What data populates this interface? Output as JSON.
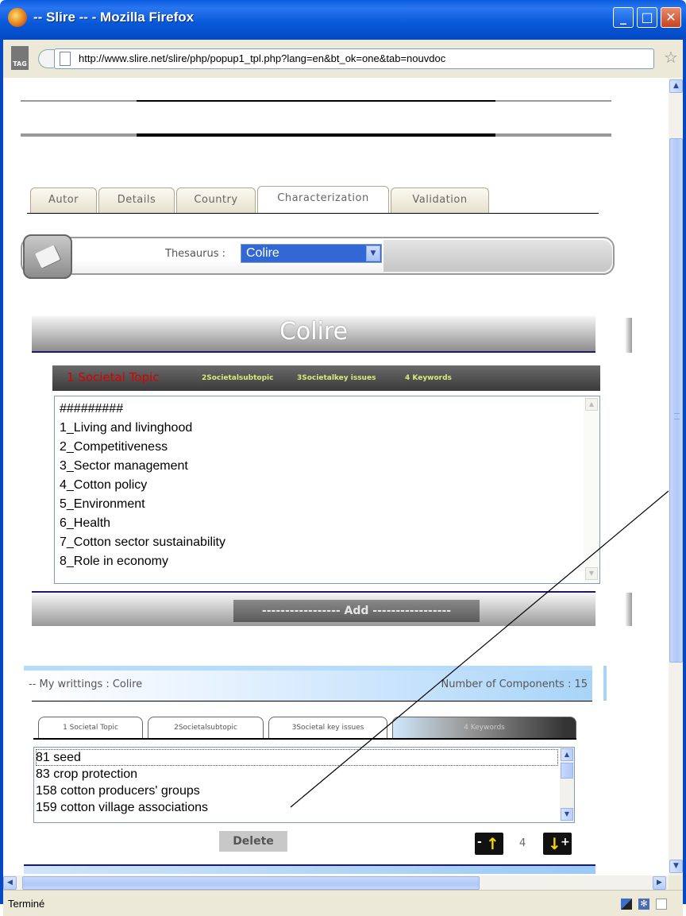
{
  "window": {
    "title": "-- Slire -- - Mozilla Firefox",
    "minimize": "_",
    "maximize": "□",
    "close": "✕"
  },
  "urlbar": {
    "url": "http://www.slire.net/slire/php/popup1_tpl.php?lang=en&bt_ok=one&tab=nouvdoc",
    "tag_label": "TAG"
  },
  "tabs": [
    {
      "label": "Autor"
    },
    {
      "label": "Details"
    },
    {
      "label": "Country"
    },
    {
      "label": "Characterization"
    },
    {
      "label": "Validation"
    }
  ],
  "active_tab": "Characterization",
  "thesaurus": {
    "label": "Thesaurus :",
    "selected": "Colire"
  },
  "section_title": "Colire",
  "breadcrumb": {
    "current": "1 Societal Topic",
    "steps": [
      "2Societalsubtopic",
      "3Societalkey issues",
      "4 Keywords"
    ]
  },
  "topics": [
    "#########",
    "1_Living and livinghood",
    "2_Competitiveness",
    "3_Sector management",
    "4_Cotton policy",
    "5_Environment",
    "6_Health",
    "7_Cotton sector sustainability",
    "8_Role in economy"
  ],
  "add_button": "----------------- Add -----------------",
  "my_writings": {
    "label": "-- My writtings : Colire",
    "count_label": "Number of Components : 15"
  },
  "subtabs": [
    "1 Societal Topic",
    "2Societalsubtopic",
    "3Societal key issues",
    "4 Keywords"
  ],
  "keywords": [
    "81 seed",
    "83 crop protection",
    "158 cotton producers' groups",
    "159 cotton village associations"
  ],
  "delete_button": "Delete",
  "position": "4",
  "status": "Terminé",
  "colors": {
    "titlebar": "#0658d8",
    "select_bg": "#3168d5",
    "crumb_current": "#d80000",
    "crumb_other": "#d7ec7a",
    "arrow_yellow": "#f5d800"
  },
  "icons": {
    "app": "firefox-icon",
    "page": "document-icon",
    "bookmark": "star-icon",
    "thesaurus": "book-icon",
    "up": "arrow-up-icon",
    "down": "arrow-down-icon"
  }
}
